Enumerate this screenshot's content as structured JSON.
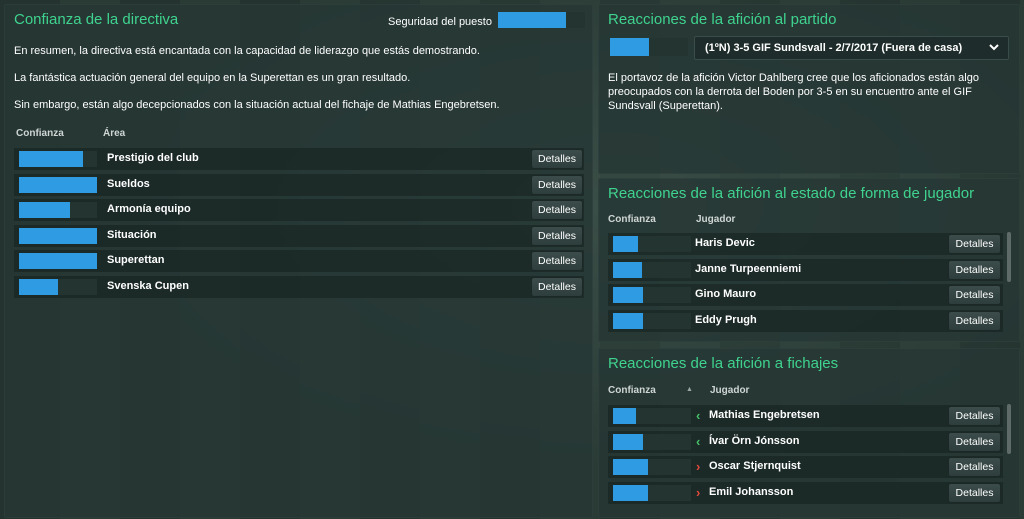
{
  "board_panel": {
    "title": "Confianza de la directiva",
    "job_security_label": "Seguridad del puesto",
    "job_security_level": 0.78,
    "paragraphs": [
      "En resumen, la directiva está encantada con la capacidad de liderazgo que estás demostrando.",
      "La fantástica actuación general del equipo en la Superettan es un gran resultado.",
      "Sin embargo, están algo decepcionados con la situación actual del fichaje de Mathias Engebretsen."
    ],
    "col_confidence": "Confianza",
    "col_area": "Área",
    "rows": [
      {
        "area": "Prestigio del club",
        "level": 0.82,
        "details": "Detalles"
      },
      {
        "area": "Sueldos",
        "level": 1.0,
        "details": "Detalles"
      },
      {
        "area": "Armonía equipo",
        "level": 0.65,
        "details": "Detalles"
      },
      {
        "area": "Situación",
        "level": 1.0,
        "details": "Detalles"
      },
      {
        "area": "Superettan",
        "level": 1.0,
        "details": "Detalles"
      },
      {
        "area": "Svenska Cupen",
        "level": 0.5,
        "details": "Detalles"
      }
    ]
  },
  "match_panel": {
    "title": "Reacciones de la afición al partido",
    "level": 0.5,
    "selected_match": "(1ºN) 3-5 GIF Sundsvall - 2/7/2017 (Fuera de casa)",
    "description_lines": [
      "El portavoz de la afición Victor Dahlberg cree que los aficionados están algo",
      "preocupados con la derrota del Boden por 3-5 en su encuentro ante el GIF",
      "Sundsvall (Superettan)."
    ]
  },
  "form_panel": {
    "title": "Reacciones de la afición al estado de forma de jugador",
    "col_confidence": "Confianza",
    "col_player": "Jugador",
    "rows": [
      {
        "player": "Haris Devic",
        "level": 0.32,
        "details": "Detalles"
      },
      {
        "player": "Janne Turpeenniemi",
        "level": 0.37,
        "details": "Detalles"
      },
      {
        "player": "Gino Mauro",
        "level": 0.39,
        "details": "Detalles"
      },
      {
        "player": "Eddy Prugh",
        "level": 0.39,
        "details": "Detalles"
      }
    ]
  },
  "signings_panel": {
    "title": "Reacciones de la afición a fichajes",
    "col_confidence": "Confianza",
    "col_player": "Jugador",
    "rows": [
      {
        "player": "Mathias Engebretsen",
        "level": 0.3,
        "direction": "in",
        "details": "Detalles"
      },
      {
        "player": "Ívar Örn Jónsson",
        "level": 0.39,
        "direction": "in",
        "details": "Detalles"
      },
      {
        "player": "Oscar Stjernquist",
        "level": 0.45,
        "direction": "out",
        "details": "Detalles"
      },
      {
        "player": "Emil Johansson",
        "level": 0.45,
        "direction": "out",
        "details": "Detalles"
      }
    ]
  },
  "colors": {
    "accent_green": "#3fd38f",
    "bar_blue": "#2f9be2",
    "arrow_in": "#46c26a",
    "arrow_out": "#e0493b"
  }
}
